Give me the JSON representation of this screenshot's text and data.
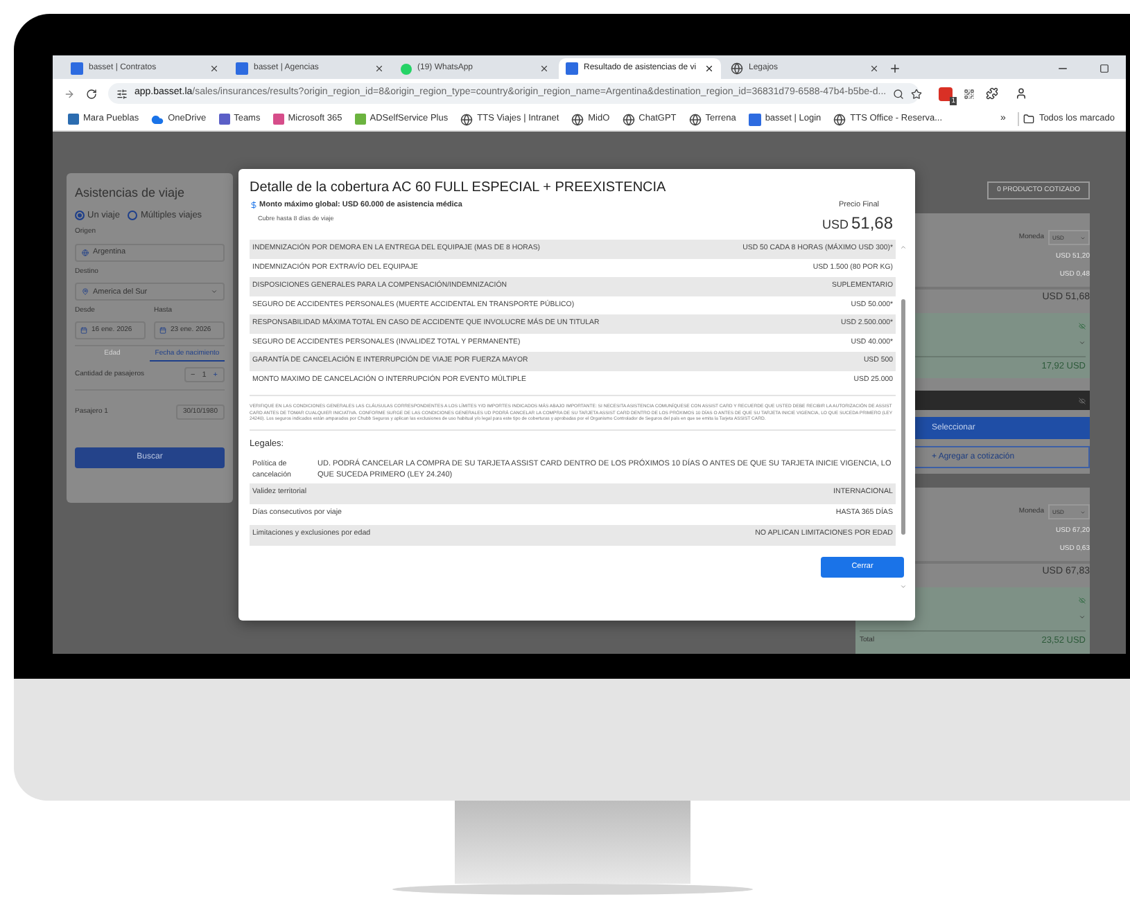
{
  "browser": {
    "tabs": [
      {
        "title": "basset | Contratos",
        "kind": "basset",
        "selected": false
      },
      {
        "title": "basset | Agencias",
        "kind": "basset",
        "selected": false
      },
      {
        "title": "(19) WhatsApp",
        "kind": "whatsapp",
        "selected": false
      },
      {
        "title": "Resultado de asistencias de vi",
        "kind": "basset",
        "selected": true
      },
      {
        "title": "Legajos",
        "kind": "globe",
        "selected": false
      }
    ],
    "url_host": "app.basset.la",
    "url_path": "/sales/insurances/results?origin_region_id=8&origin_region_type=country&origin_region_name=Argentina&destination_region_id=36831d79-6588-47b4-b5be-d...",
    "extension_badge": "1",
    "bookmarks": [
      {
        "label": "Mara Pueblas",
        "kind": "app",
        "color": "#2b6cb0"
      },
      {
        "label": "OneDrive",
        "kind": "cloud"
      },
      {
        "label": "Teams",
        "kind": "app",
        "color": "#5b5fc7"
      },
      {
        "label": "Microsoft 365",
        "kind": "app",
        "color": "#d64d8a"
      },
      {
        "label": "ADSelfService Plus",
        "kind": "app",
        "color": "#6bb33f"
      },
      {
        "label": "TTS Viajes | Intranet",
        "kind": "globe"
      },
      {
        "label": "MidO",
        "kind": "globe"
      },
      {
        "label": "ChatGPT",
        "kind": "globe"
      },
      {
        "label": "Terrena",
        "kind": "globe"
      },
      {
        "label": "basset | Login",
        "kind": "basset"
      },
      {
        "label": "TTS Office - Reserva...",
        "kind": "globe"
      }
    ],
    "more_bookmarks": "»",
    "all_bookmarks": "Todos los marcado"
  },
  "search": {
    "title": "Asistencias de viaje",
    "trip_types": [
      {
        "label": "Un viaje",
        "selected": true
      },
      {
        "label": "Múltiples viajes",
        "selected": false
      }
    ],
    "origin_label": "Origen",
    "origin": "Argentina",
    "destination_label": "Destino",
    "destination": "America del Sur",
    "from_label": "Desde",
    "from": "16 ene. 2026",
    "to_label": "Hasta",
    "to": "23 ene. 2026",
    "age_tabs": [
      {
        "label": "Edad",
        "selected": false
      },
      {
        "label": "Fecha de nacimiento",
        "selected": true
      }
    ],
    "passengers_label": "Cantidad de pasajeros",
    "minus": "−",
    "passengers": "1",
    "plus": "+",
    "passenger_label": "Pasajero 1",
    "passenger_birth": "30/10/1980",
    "button": "Buscar"
  },
  "results": {
    "quoted_button": "0 PRODUCTO COTIZADO",
    "products": [
      {
        "currency_label": "Moneda",
        "currency": "USD",
        "lines": [
          "USD 51,20",
          "USD 0,48"
        ],
        "total": "USD 51,68",
        "commission": "17,92 USD"
      },
      {
        "currency_label": "Moneda",
        "currency": "USD",
        "lines": [
          "USD 67,20",
          "USD 0,63"
        ],
        "total": "USD 67,83",
        "commission_label": "Total",
        "commission": "23,52 USD"
      }
    ],
    "select_button": "Seleccionar",
    "add_button": "+ Agregar a cotización"
  },
  "modal": {
    "title": "Detalle de la cobertura AC 60 FULL ESPECIAL + PREEXISTENCIA",
    "max_amount": "Monto máximo global: USD 60.000 de asistencia médica",
    "days": "Cubre hasta 8 días de viaje",
    "price_label": "Precio Final",
    "price_currency": "USD",
    "price": "51,68",
    "coverages": [
      {
        "name": "INDEMNIZACIÓN POR DEMORA EN LA ENTREGA DEL EQUIPAJE (MAS DE 8 HORAS)",
        "value": "USD 50 CADA 8 HORAS (MÁXIMO USD 300)*"
      },
      {
        "name": "INDEMNIZACIÓN POR EXTRAVÍO DEL EQUIPAJE",
        "value": "USD 1.500 (80 POR KG)"
      },
      {
        "name": "DISPOSICIONES GENERALES PARA LA COMPENSACIÓN/INDEMNIZACIÓN",
        "value": "SUPLEMENTARIO"
      },
      {
        "name": "SEGURO DE ACCIDENTES PERSONALES (MUERTE ACCIDENTAL EN TRANSPORTE PÚBLICO)",
        "value": "USD 50.000*"
      },
      {
        "name": "RESPONSABILIDAD MÁXIMA TOTAL EN CASO DE ACCIDENTE QUE INVOLUCRE MÁS DE UN TITULAR",
        "value": "USD 2.500.000*"
      },
      {
        "name": "SEGURO DE ACCIDENTES PERSONALES (INVALIDEZ TOTAL Y PERMANENTE)",
        "value": "USD 40.000*"
      },
      {
        "name": "GARANTÍA DE CANCELACIÓN E INTERRUPCIÓN DE VIAJE POR FUERZA MAYOR",
        "value": "USD 500"
      },
      {
        "name": "MONTO MAXIMO DE CANCELACIÓN O INTERRUPCIÓN POR EVENTO MÚLTIPLE",
        "value": "USD 25.000"
      }
    ],
    "disclaimer": "VERIFIQUE EN LAS CONDICIONES GENERALES LAS CLÁUSULAS CORRESPONDIENTES A LOS LÍMITES Y/O IMPORTES INDICADOS MÁS ABAJO IMPORTANTE: SI NECESITA ASISTENCIA COMUNÍQUESE CON ASSIST CARD Y RECUERDE QUE USTED DEBE RECIBIR LA AUTORIZACIÓN DE ASSIST CARD ANTES DE TOMAR CUALQUIER INICIATIVA. CONFORME SURGE DE LAS CONDICIONES GENERALES UD PODRÁ CANCELAR LA COMPRA DE SU TARJETA ASSIST CARD DENTRO DE LOS PRÓXIMOS 10 DÍAS O ANTES DE QUE SU TARJETA INICIE VIGENCIA, LO QUE SUCEDA PRIMERO (LEY 24240). Los seguros indicados están amparados por Chubb Seguros y aplican las exclusiones de uso habitual y/o legal para este tipo de coberturas y aprobadas por el Organismo Controlador de Seguros del país en que se emita la Tarjeta ASSIST CARD.",
    "legal_title": "Legales:",
    "legal": [
      {
        "kind": "long",
        "name": "Política de cancelación",
        "value": "UD. PODRÁ CANCELAR LA COMPRA DE SU TARJETA ASSIST CARD DENTRO DE LOS PRÓXIMOS 10 DÍAS O ANTES DE QUE SU TARJETA INICIE VIGENCIA, LO QUE SUCEDA PRIMERO (LEY 24.240)"
      },
      {
        "kind": "short",
        "name": "Validez territorial",
        "value": "INTERNACIONAL"
      },
      {
        "kind": "short",
        "name": "Días consecutivos por viaje",
        "value": "HASTA 365 DÍAS"
      },
      {
        "kind": "short",
        "name": "Limitaciones y exclusiones por edad",
        "value": "NO APLICAN LIMITACIONES POR EDAD"
      }
    ],
    "close_button": "Cerrar"
  }
}
